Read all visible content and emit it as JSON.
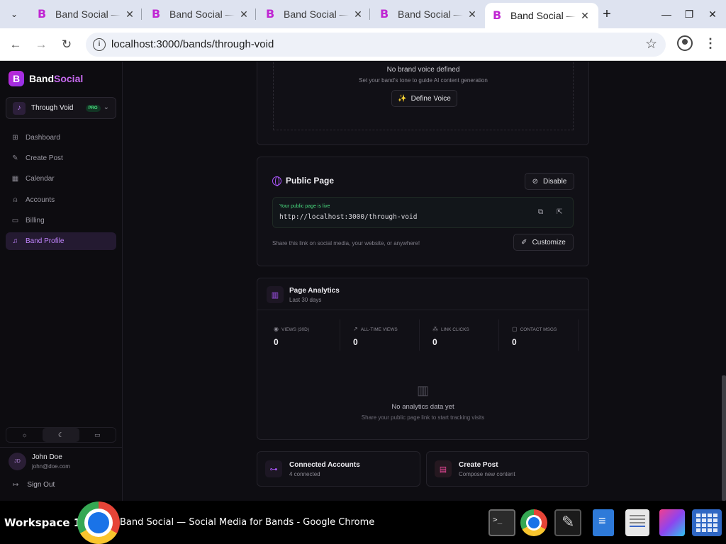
{
  "browser": {
    "tabs": [
      {
        "title": "Band Social — Social Media for Bands"
      },
      {
        "title": "Band Social — Social Media for Bands"
      },
      {
        "title": "Band Social — Social Media for Bands"
      },
      {
        "title": "Band Social — Social Media for Bands"
      },
      {
        "title": "Band Social — Social Media for Bands"
      }
    ],
    "url": "localhost:3000/bands/through-void"
  },
  "sidebar": {
    "brand_b": "Band",
    "brand_social": "Social",
    "band_name": "Through Void",
    "band_badge": "PRO",
    "nav": [
      {
        "label": "Dashboard",
        "icon": "grid-icon"
      },
      {
        "label": "Create Post",
        "icon": "pen-square-icon"
      },
      {
        "label": "Calendar",
        "icon": "calendar-icon"
      },
      {
        "label": "Accounts",
        "icon": "user-icon"
      },
      {
        "label": "Billing",
        "icon": "credit-card-icon"
      },
      {
        "label": "Band Profile",
        "icon": "guitar-icon",
        "active": true
      }
    ],
    "user_initials": "JD",
    "user_name": "John Doe",
    "user_email": "john@doe.com",
    "sign_out": "Sign Out"
  },
  "brand_voice": {
    "empty_title": "No brand voice defined",
    "empty_desc": "Set your band's tone to guide AI content generation",
    "button": "Define Voice"
  },
  "public_page": {
    "title": "Public Page",
    "disable_button": "Disable",
    "live_label": "Your public page is live",
    "url": "http://localhost:3000/through-void",
    "share_text": "Share this link on social media, your website, or anywhere!",
    "customize_button": "Customize"
  },
  "analytics": {
    "title": "Page Analytics",
    "subtitle": "Last 30 days",
    "metrics": [
      {
        "label": "Views (30d)",
        "value": "0"
      },
      {
        "label": "All-time views",
        "value": "0"
      },
      {
        "label": "Link clicks",
        "value": "0"
      },
      {
        "label": "Contact msgs",
        "value": "0"
      }
    ],
    "empty_title": "No analytics data yet",
    "empty_desc": "Share your public page link to start tracking visits"
  },
  "quick": {
    "accounts_title": "Connected Accounts",
    "accounts_sub": "4 connected",
    "post_title": "Create Post",
    "post_sub": "Compose new content"
  },
  "taskbar": {
    "workspace": "Workspace 1",
    "window_title": "Band Social — Social Media for Bands - Google Chrome"
  },
  "colors": {
    "accent": "#a855f7",
    "live": "#4ade80",
    "background": "#0e0d12"
  }
}
